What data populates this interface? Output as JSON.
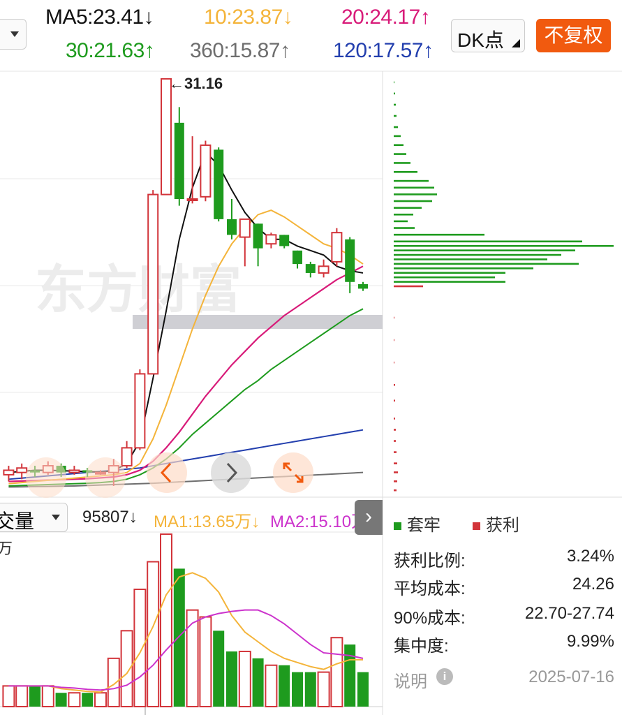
{
  "colors": {
    "ma5": "#111111",
    "ma10": "#f4b43a",
    "ma20": "#d81b79",
    "ma30": "#1e9b1e",
    "ma120": "#233fae",
    "ma360": "#6e6e6e",
    "up": "#d2343a",
    "down": "#1e9b1e",
    "accent": "#f15a0f",
    "vol_ma1": "#f4b43a",
    "vol_ma2": "#cc33cc"
  },
  "ma": {
    "ma5": "MA5:23.41↓",
    "ma10": "10:23.87↓",
    "ma20": "20:24.17↑",
    "ma30": "30:21.63↑",
    "ma360": "360:15.87↑",
    "ma120": "120:17.57↑"
  },
  "toolbar": {
    "dk_label": "DK点",
    "fuquan_label": "不复权"
  },
  "main_chart": {
    "high_label": "←31.16",
    "watermark": "东方财富"
  },
  "volume": {
    "selector_label": "交量",
    "value": "95807↓",
    "ma1": "MA1:13.65万↓",
    "ma2": "MA2:15.10万",
    "unit": "万",
    "expand_icon": "chevron-right-icon"
  },
  "chip": {
    "legend_trapped": "套牢",
    "legend_profit": "获利",
    "stats": [
      {
        "label": "获利比例:",
        "value": "3.24%"
      },
      {
        "label": "平均成本:",
        "value": "24.26"
      },
      {
        "label": "90%成本:",
        "value": "22.70-27.74"
      },
      {
        "label": "集中度:",
        "value": "9.99%"
      }
    ],
    "note": "说明",
    "date": "2025-07-16"
  },
  "chart_data": {
    "type": "candlestick",
    "price_range": [
      12.5,
      31.5
    ],
    "candles": [
      {
        "o": 13.5,
        "c": 13.7,
        "h": 13.9,
        "l": 13.2
      },
      {
        "o": 13.6,
        "c": 13.8,
        "h": 14.0,
        "l": 13.3
      },
      {
        "o": 13.7,
        "c": 13.6,
        "h": 13.9,
        "l": 13.4
      },
      {
        "o": 13.6,
        "c": 13.9,
        "h": 14.1,
        "l": 13.5
      },
      {
        "o": 13.9,
        "c": 13.6,
        "h": 14.0,
        "l": 13.4
      },
      {
        "o": 13.6,
        "c": 13.7,
        "h": 13.9,
        "l": 13.5
      },
      {
        "o": 13.7,
        "c": 13.6,
        "h": 13.8,
        "l": 13.4
      },
      {
        "o": 13.6,
        "c": 13.6,
        "h": 13.7,
        "l": 13.5
      },
      {
        "o": 13.6,
        "c": 13.9,
        "h": 14.2,
        "l": 13.0
      },
      {
        "o": 13.9,
        "c": 14.7,
        "h": 15.0,
        "l": 13.8
      },
      {
        "o": 14.7,
        "c": 18.0,
        "h": 18.2,
        "l": 14.6
      },
      {
        "o": 18.0,
        "c": 26.0,
        "h": 26.2,
        "l": 18.0
      },
      {
        "o": 26.0,
        "c": 31.16,
        "h": 31.16,
        "l": 26.0
      },
      {
        "o": 29.2,
        "c": 25.8,
        "h": 29.9,
        "l": 25.5
      },
      {
        "o": 25.8,
        "c": 25.8,
        "h": 28.6,
        "l": 25.6
      },
      {
        "o": 25.9,
        "c": 28.2,
        "h": 28.4,
        "l": 25.7
      },
      {
        "o": 28.0,
        "c": 24.9,
        "h": 28.1,
        "l": 24.8
      },
      {
        "o": 24.9,
        "c": 24.2,
        "h": 25.8,
        "l": 24.0
      },
      {
        "o": 24.1,
        "c": 24.9,
        "h": 24.9,
        "l": 22.8
      },
      {
        "o": 24.7,
        "c": 23.6,
        "h": 24.7,
        "l": 22.8
      },
      {
        "o": 23.8,
        "c": 24.2,
        "h": 24.3,
        "l": 23.6
      },
      {
        "o": 24.2,
        "c": 23.7,
        "h": 24.2,
        "l": 23.6
      },
      {
        "o": 23.5,
        "c": 22.9,
        "h": 23.5,
        "l": 22.7
      },
      {
        "o": 22.9,
        "c": 22.5,
        "h": 23.0,
        "l": 22.3
      },
      {
        "o": 22.5,
        "c": 22.8,
        "h": 23.1,
        "l": 22.3
      },
      {
        "o": 23.0,
        "c": 24.3,
        "h": 24.5,
        "l": 22.8
      },
      {
        "o": 24.0,
        "c": 22.1,
        "h": 24.1,
        "l": 21.6
      },
      {
        "o": 22.0,
        "c": 21.8,
        "h": 22.1,
        "l": 21.7
      }
    ],
    "ma5": [
      13.6,
      13.65,
      13.7,
      13.7,
      13.68,
      13.66,
      13.64,
      13.62,
      13.68,
      14.0,
      15.0,
      17.8,
      20.8,
      24.0,
      26.3,
      27.9,
      27.3,
      26.2,
      25.2,
      24.5,
      24.0,
      24.0,
      23.7,
      23.5,
      23.3,
      22.8,
      22.6,
      22.5
    ],
    "ma10": [
      13.1,
      13.15,
      13.2,
      13.25,
      13.3,
      13.35,
      13.4,
      13.45,
      13.5,
      13.6,
      14.0,
      15.1,
      16.6,
      18.3,
      20.0,
      21.5,
      22.8,
      23.8,
      24.5,
      25.1,
      25.3,
      25.0,
      24.6,
      24.2,
      23.8,
      23.6,
      23.3,
      22.9
    ],
    "ma20": [
      13.2,
      13.22,
      13.24,
      13.26,
      13.28,
      13.3,
      13.32,
      13.36,
      13.4,
      13.5,
      13.7,
      14.1,
      14.7,
      15.4,
      16.2,
      17.0,
      17.7,
      18.4,
      19.0,
      19.6,
      20.1,
      20.6,
      21.0,
      21.4,
      21.8,
      22.2,
      22.5,
      22.8
    ],
    "ma30": [
      13.0,
      13.02,
      13.04,
      13.06,
      13.08,
      13.1,
      13.12,
      13.15,
      13.2,
      13.3,
      13.5,
      13.8,
      14.2,
      14.7,
      15.3,
      15.8,
      16.3,
      16.8,
      17.3,
      17.7,
      18.2,
      18.6,
      19.0,
      19.4,
      19.8,
      20.2,
      20.6,
      20.9
    ],
    "ma120": [
      13.3,
      13.35,
      13.4,
      13.45,
      13.5,
      13.55,
      13.6,
      13.65,
      13.7,
      13.75,
      13.8,
      13.9,
      14.0,
      14.1,
      14.2,
      14.3,
      14.4,
      14.5,
      14.6,
      14.7,
      14.8,
      14.9,
      15.0,
      15.1,
      15.2,
      15.3,
      15.4,
      15.5
    ],
    "ma360": [
      12.95,
      12.96,
      12.97,
      12.98,
      12.99,
      13.0,
      13.02,
      13.04,
      13.06,
      13.08,
      13.1,
      13.12,
      13.15,
      13.18,
      13.21,
      13.24,
      13.27,
      13.3,
      13.33,
      13.36,
      13.39,
      13.42,
      13.45,
      13.48,
      13.51,
      13.54,
      13.57,
      13.6
    ],
    "volume": [
      3,
      3,
      3,
      3,
      2,
      2,
      2,
      2,
      7,
      11,
      17,
      21,
      25,
      20,
      14,
      13,
      11,
      8,
      8,
      7,
      6,
      6,
      5,
      5,
      5,
      10,
      9,
      5
    ],
    "vol_ma1": [
      3,
      3,
      3,
      3,
      2.6,
      2.4,
      2.2,
      2.1,
      3.2,
      4.8,
      7.8,
      11.6,
      16.2,
      18.8,
      19.4,
      18.6,
      16.6,
      13.2,
      10.8,
      9.4,
      8.0,
      7.0,
      6.4,
      5.8,
      5.4,
      6.2,
      6.8,
      6.8
    ],
    "vol_ma2": [
      3,
      3,
      3,
      3,
      2.8,
      2.7,
      2.5,
      2.4,
      2.6,
      3.1,
      4.3,
      6.0,
      8.2,
      10.2,
      12.1,
      13.0,
      13.5,
      13.8,
      14.0,
      14.0,
      13.2,
      12.0,
      10.5,
      9.0,
      7.8,
      7.6,
      7.4,
      7.0
    ]
  },
  "chip_bars": {
    "trapped": [
      {
        "p": 31.0,
        "w": 1
      },
      {
        "p": 30.5,
        "w": 2
      },
      {
        "p": 30.0,
        "w": 3
      },
      {
        "p": 29.5,
        "w": 4
      },
      {
        "p": 29.0,
        "w": 6
      },
      {
        "p": 28.6,
        "w": 10
      },
      {
        "p": 28.2,
        "w": 14
      },
      {
        "p": 27.8,
        "w": 18
      },
      {
        "p": 27.4,
        "w": 24
      },
      {
        "p": 27.0,
        "w": 34
      },
      {
        "p": 26.6,
        "w": 50
      },
      {
        "p": 26.3,
        "w": 58
      },
      {
        "p": 26.0,
        "w": 62
      },
      {
        "p": 25.7,
        "w": 55
      },
      {
        "p": 25.4,
        "w": 40
      },
      {
        "p": 25.1,
        "w": 28
      },
      {
        "p": 24.8,
        "w": 20
      },
      {
        "p": 24.5,
        "w": 30
      },
      {
        "p": 24.2,
        "w": 130
      },
      {
        "p": 23.9,
        "w": 270
      },
      {
        "p": 23.7,
        "w": 315
      },
      {
        "p": 23.5,
        "w": 260
      },
      {
        "p": 23.3,
        "w": 240
      },
      {
        "p": 23.1,
        "w": 220
      },
      {
        "p": 22.9,
        "w": 265
      },
      {
        "p": 22.7,
        "w": 200
      },
      {
        "p": 22.5,
        "w": 160
      },
      {
        "p": 22.3,
        "w": 145
      },
      {
        "p": 22.1,
        "w": 160
      }
    ],
    "profit": [
      {
        "p": 21.9,
        "w": 42
      },
      {
        "p": 20.5,
        "w": 1
      },
      {
        "p": 19.5,
        "w": 1
      },
      {
        "p": 18.5,
        "w": 1
      },
      {
        "p": 17.5,
        "w": 2
      },
      {
        "p": 16.8,
        "w": 2
      },
      {
        "p": 16.0,
        "w": 2
      },
      {
        "p": 15.5,
        "w": 3
      },
      {
        "p": 15.0,
        "w": 3
      },
      {
        "p": 14.5,
        "w": 4
      },
      {
        "p": 14.0,
        "w": 5
      },
      {
        "p": 13.6,
        "w": 6
      },
      {
        "p": 13.2,
        "w": 5
      },
      {
        "p": 12.8,
        "w": 4
      }
    ]
  }
}
